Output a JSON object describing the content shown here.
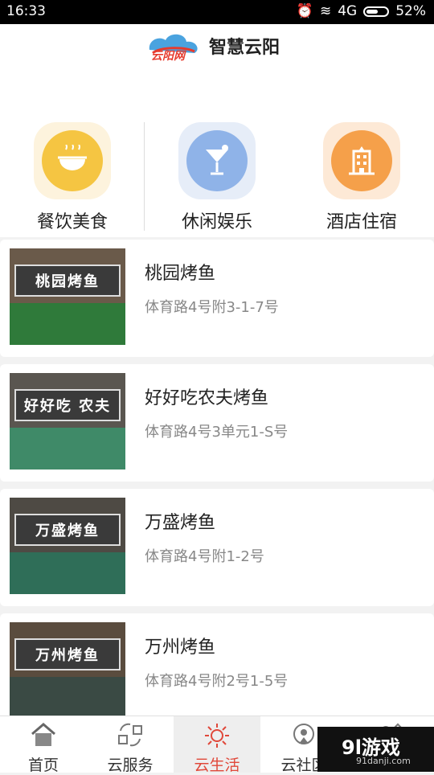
{
  "status_bar": {
    "time": "16:33",
    "battery": "52%",
    "carrier_text": "4G",
    "battery_level": 0.52
  },
  "header": {
    "logo_text": "云阳网",
    "title": "智慧云阳"
  },
  "categories": [
    {
      "label": "餐饮美食",
      "icon": "noodle-bowl-icon",
      "color": "#f5c542"
    },
    {
      "label": "休闲娱乐",
      "icon": "cocktail-icon",
      "color": "#8fb3e8"
    },
    {
      "label": "酒店住宿",
      "icon": "hotel-building-icon",
      "color": "#f5a04a"
    }
  ],
  "list": [
    {
      "name": "桃园烤鱼",
      "address": "体育路4号附3-1-7号",
      "sign_text": "桃园烤鱼",
      "awning_color": "#2f7a3a"
    },
    {
      "name": "好好吃农夫烤鱼",
      "address": "体育路4号3单元1-S号",
      "sign_text": "好好吃 农夫",
      "awning_color": "#3f8a68"
    },
    {
      "name": "万盛烤鱼",
      "address": "体育路4号附1-2号",
      "sign_text": "万盛烤鱼",
      "awning_color": "#2f6e58"
    },
    {
      "name": "万州烤鱼",
      "address": "体育路4号附2号1-5号",
      "sign_text": "万州烤鱼",
      "awning_color": "#3a4a44"
    }
  ],
  "tabs": [
    {
      "label": "首页",
      "icon": "home-icon"
    },
    {
      "label": "云服务",
      "icon": "service-icon"
    },
    {
      "label": "云生活",
      "icon": "sun-icon",
      "active": true
    },
    {
      "label": "云社区",
      "icon": "community-icon"
    },
    {
      "label": "",
      "icon": "more-icon"
    }
  ],
  "watermark": {
    "text": "9l游戏",
    "url": "91danji.com"
  },
  "colors": {
    "accent": "#e0483a"
  }
}
